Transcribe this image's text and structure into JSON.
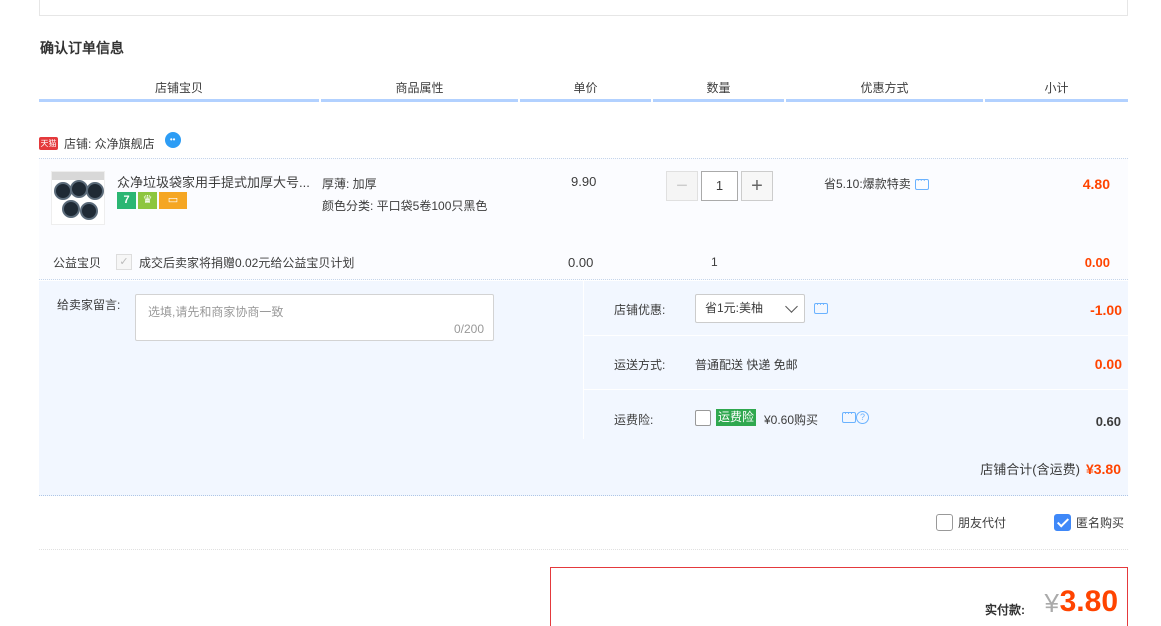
{
  "page_title": "确认订单信息",
  "columns": [
    "店铺宝贝",
    "商品属性",
    "单价",
    "数量",
    "优惠方式",
    "小计"
  ],
  "shop": {
    "badge": "天猫",
    "label": "店铺: 众净旗舰店"
  },
  "item": {
    "title": "众净垃圾袋家用手提式加厚大号...",
    "icon_7": "7",
    "attr_1": "厚薄: 加厚",
    "attr_2": "颜色分类: 平口袋5卷100只黑色",
    "price": "9.90",
    "quantity": "1",
    "minus": "−",
    "plus": "+",
    "promo": "省5.10:爆款特卖",
    "subtotal": "4.80"
  },
  "charity": {
    "label": "公益宝贝",
    "text": "成交后卖家将捐赠0.02元给公益宝贝计划",
    "price": "0.00",
    "quantity": "1",
    "subtotal": "0.00"
  },
  "message": {
    "label": "给卖家留言:",
    "placeholder": "选填,请先和商家协商一致",
    "count": "0/200"
  },
  "shop_discount": {
    "label": "店铺优惠:",
    "selected": "省1元:美柚",
    "value": "-1.00"
  },
  "shipping": {
    "label": "运送方式:",
    "text": "普通配送 快递 免邮",
    "value": "0.00"
  },
  "insurance": {
    "label": "运费险:",
    "badge": "运费险",
    "price_text": "¥0.60购买",
    "value": "0.60"
  },
  "shop_total": {
    "label": "店铺合计(含运费)",
    "value": "¥3.80"
  },
  "options": {
    "friend_pay": "朋友代付",
    "anonymous": "匿名购买"
  },
  "payment": {
    "label": "实付款:",
    "currency": "¥",
    "value": "3.80"
  },
  "colors": {
    "accent": "#ff4400",
    "header_border": "#b2d1ff",
    "info_bg": "#f2f7ff",
    "check_blue": "#3f88f8"
  }
}
